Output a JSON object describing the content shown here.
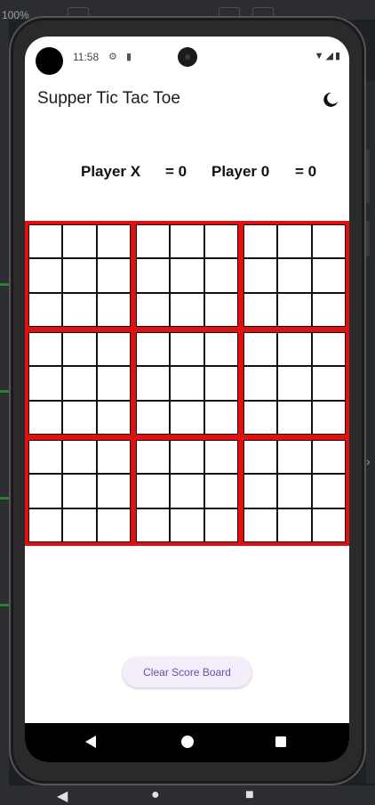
{
  "emulator": {
    "zoom": "100%"
  },
  "status_bar": {
    "time": "11:58",
    "settings_icon": "gear-icon",
    "sd_icon": "sd-card-icon",
    "wifi_icon": "wifi-icon",
    "signal_icon": "signal-icon",
    "battery_icon": "battery-icon"
  },
  "app_bar": {
    "title": "Supper Tic Tac Toe",
    "theme_icon": "moon-icon"
  },
  "scores": {
    "player_x_label": "Player X",
    "player_x_score": "= 0",
    "player_o_label": "Player 0",
    "player_o_score": "= 0"
  },
  "board": {
    "sub_boards": 9,
    "cells_per_sub_board": 9,
    "border_color": "#e01010"
  },
  "actions": {
    "clear_label": "Clear Score Board"
  },
  "colors": {
    "accent": "#6750a4",
    "button_bg": "#f4eefb"
  }
}
